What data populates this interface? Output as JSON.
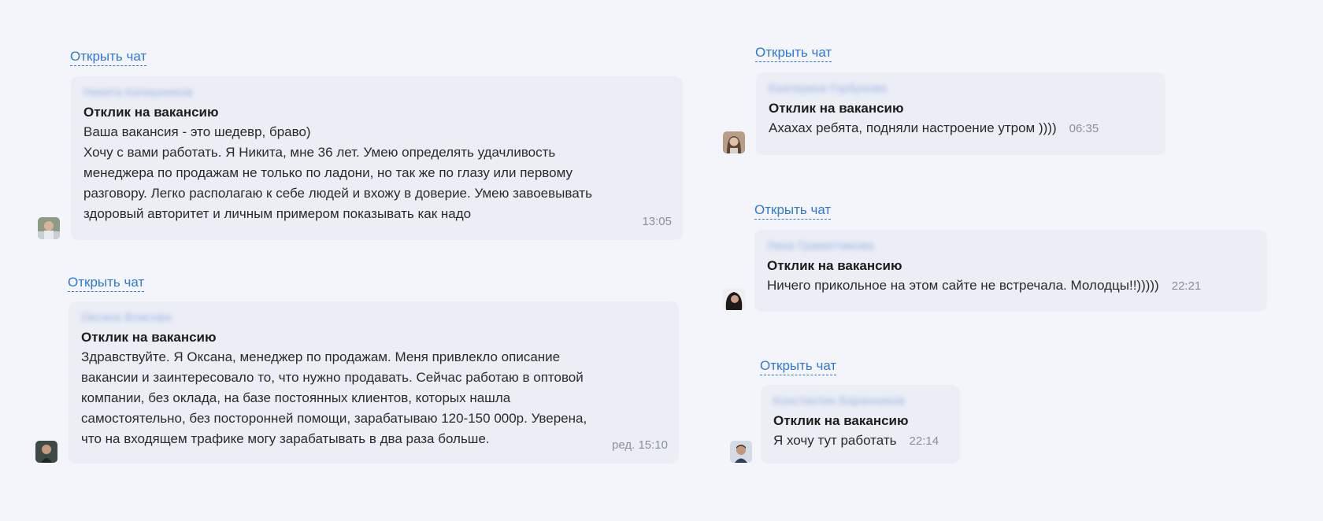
{
  "messages": [
    {
      "open_chat": "Открыть чат",
      "sender": "Никита Капишников",
      "subject": "Отклик на вакансию",
      "body": "Ваша вакансия - это шедевр, браво)\nХочу с вами работать. Я Никита, мне 36 лет. Умею определять удачливость\nменеджера по продажам не только по ладони, но так же по глазу или первому\nразговору. Легко располагаю к себе людей и вхожу в доверие. Умею завоевывать\nздоровый авторитет и личным примером показывать как надо",
      "time": "13:05"
    },
    {
      "open_chat": "Открыть чат",
      "sender": "Оксана Власова",
      "subject": "Отклик на вакансию",
      "body": "Здравствуйте. Я Оксана, менеджер по продажам. Меня привлекло описание\nвакансии и заинтересовало то, что нужно продавать. Сейчас работаю в оптовой\nкомпании, без оклада, на базе постоянных клиентов, которых нашла\nсамостоятельно, без посторонней помощи, зарабатываю 120-150 000р. Уверена,\nчто на входящем трафике могу зарабатывать в два раза больше.",
      "time": "ред. 15:10"
    },
    {
      "open_chat": "Открыть чат",
      "sender": "Екатерина Горбунова",
      "subject": "Отклик на вакансию",
      "body": "Ахахах ребята, подняли настроение утром ))))",
      "time": "06:35"
    },
    {
      "open_chat": "Открыть чат",
      "sender": "Лина Граматчикова",
      "subject": "Отклик на вакансию",
      "body": "Ничего прикольное на этом сайте не встречала. Молодцы!!)))))",
      "time": "22:21"
    },
    {
      "open_chat": "Открыть чат",
      "sender": "Константин Баранников",
      "subject": "Отклик на вакансию",
      "body": "Я хочу тут работать",
      "time": "22:14"
    }
  ],
  "colors": {
    "background": "#f3f5fa",
    "bubble": "#ebeef5",
    "link": "#2f78d4",
    "time": "#8b8f99"
  },
  "icons": [
    "avatar-photo"
  ]
}
